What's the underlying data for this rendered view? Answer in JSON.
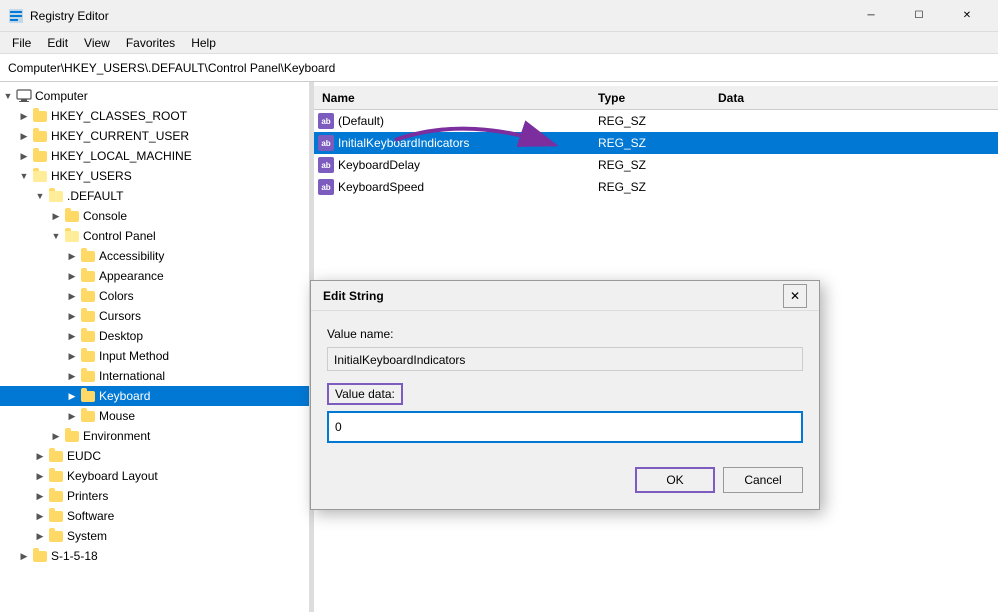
{
  "titleBar": {
    "title": "Registry Editor",
    "icon": "registry-icon"
  },
  "menuBar": {
    "items": [
      "File",
      "Edit",
      "View",
      "Favorites",
      "Help"
    ]
  },
  "addressBar": {
    "path": "Computer\\HKEY_USERS\\.DEFAULT\\Control Panel\\Keyboard"
  },
  "treePanel": {
    "items": [
      {
        "id": "computer",
        "label": "Computer",
        "level": 0,
        "expanded": true,
        "type": "computer"
      },
      {
        "id": "hkey-classes",
        "label": "HKEY_CLASSES_ROOT",
        "level": 1,
        "expanded": false,
        "type": "folder"
      },
      {
        "id": "hkey-current",
        "label": "HKEY_CURRENT_USER",
        "level": 1,
        "expanded": false,
        "type": "folder"
      },
      {
        "id": "hkey-local",
        "label": "HKEY_LOCAL_MACHINE",
        "level": 1,
        "expanded": false,
        "type": "folder"
      },
      {
        "id": "hkey-users",
        "label": "HKEY_USERS",
        "level": 1,
        "expanded": true,
        "type": "folder"
      },
      {
        "id": "default",
        "label": ".DEFAULT",
        "level": 2,
        "expanded": true,
        "type": "folder"
      },
      {
        "id": "console",
        "label": "Console",
        "level": 3,
        "expanded": false,
        "type": "folder"
      },
      {
        "id": "control-panel",
        "label": "Control Panel",
        "level": 3,
        "expanded": true,
        "type": "folder"
      },
      {
        "id": "accessibility",
        "label": "Accessibility",
        "level": 4,
        "expanded": false,
        "type": "folder"
      },
      {
        "id": "appearance",
        "label": "Appearance",
        "level": 4,
        "expanded": false,
        "type": "folder"
      },
      {
        "id": "colors",
        "label": "Colors",
        "level": 4,
        "expanded": false,
        "type": "folder"
      },
      {
        "id": "cursors",
        "label": "Cursors",
        "level": 4,
        "expanded": false,
        "type": "folder"
      },
      {
        "id": "desktop",
        "label": "Desktop",
        "level": 4,
        "expanded": false,
        "type": "folder"
      },
      {
        "id": "input-method",
        "label": "Input Method",
        "level": 4,
        "expanded": false,
        "type": "folder"
      },
      {
        "id": "international",
        "label": "International",
        "level": 4,
        "expanded": false,
        "type": "folder"
      },
      {
        "id": "keyboard",
        "label": "Keyboard",
        "level": 4,
        "expanded": false,
        "type": "folder",
        "selected": true
      },
      {
        "id": "mouse",
        "label": "Mouse",
        "level": 4,
        "expanded": false,
        "type": "folder"
      },
      {
        "id": "environment",
        "label": "Environment",
        "level": 3,
        "expanded": false,
        "type": "folder"
      },
      {
        "id": "eudc",
        "label": "EUDC",
        "level": 2,
        "expanded": false,
        "type": "folder"
      },
      {
        "id": "keyboard-layout",
        "label": "Keyboard Layout",
        "level": 2,
        "expanded": false,
        "type": "folder"
      },
      {
        "id": "printers",
        "label": "Printers",
        "level": 2,
        "expanded": false,
        "type": "folder"
      },
      {
        "id": "software",
        "label": "Software",
        "level": 2,
        "expanded": false,
        "type": "folder"
      },
      {
        "id": "system",
        "label": "System",
        "level": 2,
        "expanded": false,
        "type": "folder"
      },
      {
        "id": "s-1-5-18",
        "label": "S-1-5-18",
        "level": 1,
        "expanded": false,
        "type": "folder"
      }
    ]
  },
  "registryPanel": {
    "columns": [
      "Name",
      "Type",
      "Data"
    ],
    "rows": [
      {
        "name": "(Default)",
        "type": "REG_SZ",
        "data": "",
        "selected": false
      },
      {
        "name": "InitialKeyboardIndicators",
        "type": "REG_SZ",
        "data": "",
        "selected": true
      },
      {
        "name": "KeyboardDelay",
        "type": "REG_SZ",
        "data": "",
        "selected": false
      },
      {
        "name": "KeyboardSpeed",
        "type": "REG_SZ",
        "data": "",
        "selected": false
      }
    ]
  },
  "dialog": {
    "title": "Edit String",
    "valueNameLabel": "Value name:",
    "valueName": "InitialKeyboardIndicators",
    "valueDataLabel": "Value data:",
    "valueData": "0",
    "okLabel": "OK",
    "cancelLabel": "Cancel"
  }
}
